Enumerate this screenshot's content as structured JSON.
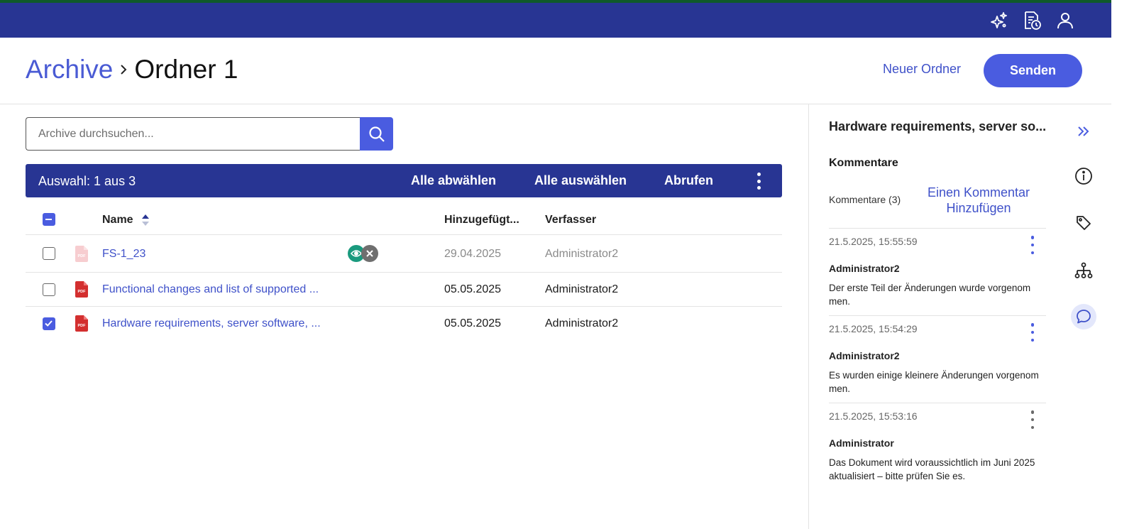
{
  "topbar": {
    "icons": [
      "sparkles-icon",
      "document-clock-icon",
      "user-icon"
    ]
  },
  "header": {
    "breadcrumb_root": "Archive",
    "breadcrumb_current": "Ordner 1",
    "new_folder_label": "Neuer Ordner",
    "send_label": "Senden"
  },
  "search": {
    "placeholder": "Archive durchsuchen..."
  },
  "selection_bar": {
    "count_label": "Auswahl: 1 aus 3",
    "deselect_all": "Alle abwählen",
    "select_all": "Alle auswählen",
    "retrieve": "Abrufen"
  },
  "table": {
    "columns": {
      "name": "Name",
      "added": "Hinzugefügt...",
      "author": "Verfasser"
    },
    "rows": [
      {
        "name": "FS-1_23",
        "date": "29.04.2025",
        "author": "Administrator2",
        "checked": false,
        "dimmed": true,
        "status_icons": [
          "eye-icon",
          "close-icon"
        ]
      },
      {
        "name": "Functional changes and list of supported ...",
        "date": "05.05.2025",
        "author": "Administrator2",
        "checked": false,
        "dimmed": false
      },
      {
        "name": "Hardware requirements, server software, ...",
        "date": "05.05.2025",
        "author": "Administrator2",
        "checked": true,
        "dimmed": false
      }
    ]
  },
  "panel": {
    "title": "Hardware requirements, server so...",
    "section_title": "Kommentare",
    "comment_count": "Kommentare (3)",
    "add_comment": "Einen Kommentar Hinzufügen",
    "comments": [
      {
        "timestamp": "21.5.2025, 15:55:59",
        "author": "Administrator2",
        "text": "Der erste Teil der Änderungen wurde vorgenom men."
      },
      {
        "timestamp": "21.5.2025, 15:54:29",
        "author": "Administrator2",
        "text": "Es wurden einige kleinere Änderungen vorgenom men."
      },
      {
        "timestamp": "21.5.2025, 15:53:16",
        "author": "Administrator",
        "text": "Das Dokument wird voraussichtlich im Juni 2025 aktualisiert – bitte prüfen Sie es."
      }
    ]
  },
  "side_rail": {
    "icons": [
      "double-chevron-right-icon",
      "info-icon",
      "tag-icon",
      "hierarchy-icon",
      "comment-icon"
    ],
    "active": "comment-icon"
  },
  "colors": {
    "primary_dark": "#283593",
    "primary": "#4a5ce0",
    "link": "#3f51c9",
    "pdf_red": "#d32f2f",
    "status_green": "#1a9a7e"
  }
}
